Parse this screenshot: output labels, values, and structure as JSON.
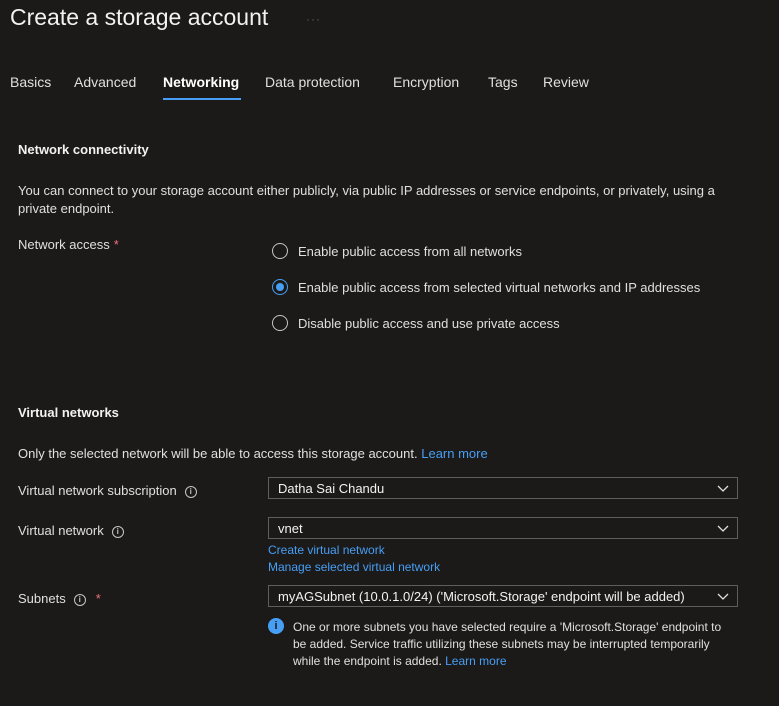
{
  "header": {
    "title": "Create a storage account",
    "more_glyph": "···"
  },
  "tabs": [
    {
      "label": "Basics",
      "active": false
    },
    {
      "label": "Advanced",
      "active": false
    },
    {
      "label": "Networking",
      "active": true
    },
    {
      "label": "Data protection",
      "active": false
    },
    {
      "label": "Encryption",
      "active": false
    },
    {
      "label": "Tags",
      "active": false
    },
    {
      "label": "Review",
      "active": false
    }
  ],
  "network_connectivity": {
    "title": "Network connectivity",
    "description": "You can connect to your storage account either publicly, via public IP addresses or service endpoints, or privately, using a private endpoint.",
    "access_label": "Network access",
    "required_mark": "*",
    "options": [
      {
        "label": "Enable public access from all networks",
        "selected": false
      },
      {
        "label": "Enable public access from selected virtual networks and IP addresses",
        "selected": true
      },
      {
        "label": "Disable public access and use private access",
        "selected": false
      }
    ]
  },
  "virtual_networks": {
    "title": "Virtual networks",
    "description": "Only the selected network will be able to access this storage account.",
    "learn_more": "Learn more",
    "subscription_label": "Virtual network subscription",
    "subscription_value": "Datha Sai Chandu",
    "vnet_label": "Virtual network",
    "vnet_value": "vnet",
    "create_link": "Create virtual network",
    "manage_link": "Manage selected virtual network",
    "subnets_label": "Subnets",
    "subnets_required": "*",
    "subnets_value": "myAGSubnet (10.0.1.0/24) ('Microsoft.Storage' endpoint will be added)",
    "notice_text": "One or more subnets you have selected require a 'Microsoft.Storage' endpoint to be added. Service traffic utilizing these subnets may be interrupted temporarily while the endpoint is added.",
    "notice_learn_more": "Learn more"
  },
  "icons": {
    "info": "info-icon",
    "chevron": "chevron-down-icon",
    "accent": "#479ef5"
  }
}
